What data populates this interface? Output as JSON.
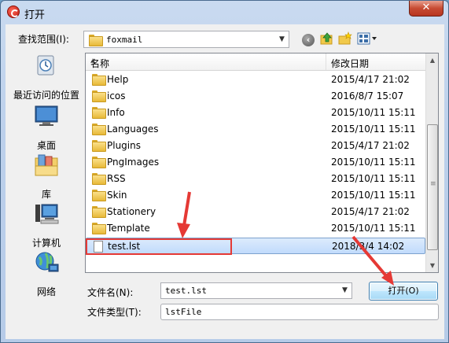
{
  "window": {
    "title": "打开",
    "close_label": "✕"
  },
  "toolbar": {
    "look_in_label": "查找范围(I):",
    "look_in_value": "foxmail"
  },
  "places": [
    {
      "label": "最近访问的位置",
      "icon": "recent-places-icon"
    },
    {
      "label": "桌面",
      "icon": "desktop-icon"
    },
    {
      "label": "库",
      "icon": "libraries-icon"
    },
    {
      "label": "计算机",
      "icon": "computer-icon"
    },
    {
      "label": "网络",
      "icon": "network-icon"
    }
  ],
  "file_list": {
    "columns": [
      "名称",
      "修改日期"
    ],
    "rows": [
      {
        "name": "Help",
        "date": "2015/4/17 21:02",
        "type": "folder"
      },
      {
        "name": "icos",
        "date": "2016/8/7 15:07",
        "type": "folder"
      },
      {
        "name": "Info",
        "date": "2015/10/11 15:11",
        "type": "folder"
      },
      {
        "name": "Languages",
        "date": "2015/10/11 15:11",
        "type": "folder"
      },
      {
        "name": "Plugins",
        "date": "2015/4/17 21:02",
        "type": "folder"
      },
      {
        "name": "PngImages",
        "date": "2015/10/11 15:11",
        "type": "folder"
      },
      {
        "name": "RSS",
        "date": "2015/10/11 15:11",
        "type": "folder"
      },
      {
        "name": "Skin",
        "date": "2015/10/11 15:11",
        "type": "folder"
      },
      {
        "name": "Stationery",
        "date": "2015/4/17 21:02",
        "type": "folder"
      },
      {
        "name": "Template",
        "date": "2015/10/11 15:11",
        "type": "folder"
      },
      {
        "name": "test.lst",
        "date": "2018/3/4 14:02",
        "type": "file",
        "selected": true
      }
    ]
  },
  "footer": {
    "filename_label": "文件名(N):",
    "filename_value": "test.lst",
    "filetype_label": "文件类型(T):",
    "filetype_value": "lstFile",
    "open_button": "打开(O)"
  },
  "annotation_color": "#e53935"
}
